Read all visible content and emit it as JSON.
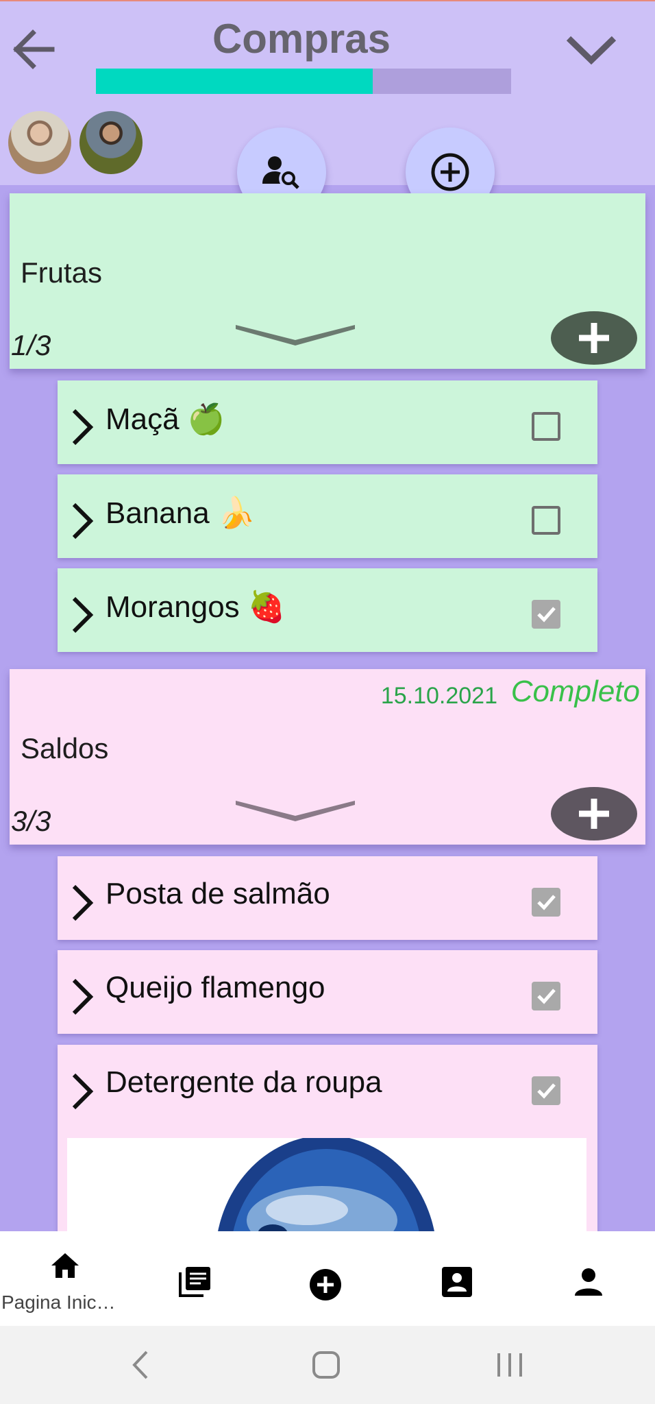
{
  "header": {
    "title": "Compras",
    "progress_fraction": 0.667,
    "progress_color": "#00d9c0",
    "back_icon": "arrow-left-icon",
    "collapse_icon": "chevron-down-icon",
    "search_user_icon": "person-search-icon",
    "add_icon": "plus-circle-icon"
  },
  "categories": [
    {
      "name": "Frutas",
      "count": "1/3",
      "items": [
        {
          "label": "Maçã 🍏",
          "checked": false
        },
        {
          "label": "Banana 🍌",
          "checked": false
        },
        {
          "label": "Morangos 🍓",
          "checked": true
        }
      ]
    },
    {
      "name": "Saldos",
      "count": "3/3",
      "date": "15.10.2021",
      "status": "Completo",
      "items": [
        {
          "label": "Posta de salmão",
          "checked": true
        },
        {
          "label": "Queijo flamengo",
          "checked": true
        },
        {
          "label": "Detergente da roupa",
          "checked": true
        }
      ]
    }
  ],
  "bottom_nav": {
    "items": [
      {
        "icon": "home-icon",
        "label": "Pagina Inic…"
      },
      {
        "icon": "list-icon"
      },
      {
        "icon": "add-circle-icon"
      },
      {
        "icon": "contact-card-icon"
      },
      {
        "icon": "person-icon"
      }
    ]
  },
  "colors": {
    "background": "#b3a3ef",
    "header": "#cdc1f7",
    "green_card": "#ccf5da",
    "pink_card": "#fde0f6",
    "complete_text": "#39c04a"
  }
}
